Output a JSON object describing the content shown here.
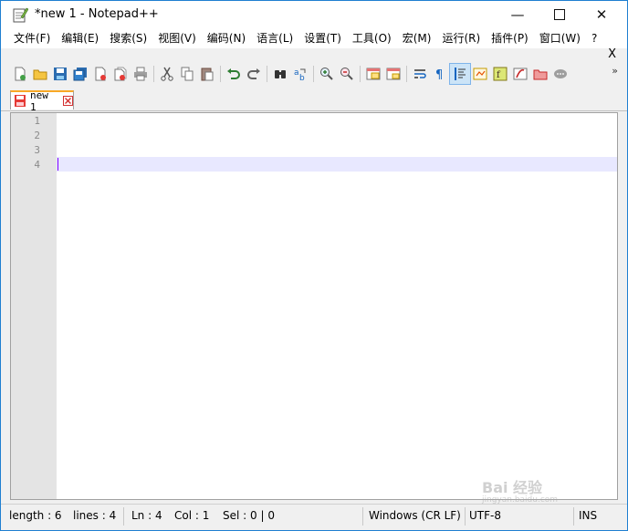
{
  "window": {
    "title": "*new 1 - Notepad++",
    "min_glyph": "—",
    "close_glyph": "✕"
  },
  "menu": {
    "items": [
      "文件(F)",
      "编辑(E)",
      "搜索(S)",
      "视图(V)",
      "编码(N)",
      "语言(L)",
      "设置(T)",
      "工具(O)",
      "宏(M)",
      "运行(R)",
      "插件(P)",
      "窗口(W)",
      "?"
    ],
    "close_doc_glyph": "X"
  },
  "toolbar": {
    "icons": [
      "new-file-icon",
      "open-file-icon",
      "save-icon",
      "save-all-icon",
      "close-icon",
      "close-all-icon",
      "print-icon",
      "cut-icon",
      "copy-icon",
      "paste-icon",
      "undo-icon",
      "redo-icon",
      "find-icon",
      "replace-icon",
      "zoom-in-icon",
      "zoom-out-icon",
      "sync-vertical-icon",
      "sync-horizontal-icon",
      "word-wrap-icon",
      "show-all-chars-icon",
      "indent-guide-icon",
      "doc-map-icon",
      "function-list-icon",
      "folder-workspace-icon",
      "monitoring-icon",
      "macro-icon"
    ],
    "more_glyph": "»"
  },
  "tabs": [
    {
      "label": "new 1",
      "active": true
    }
  ],
  "editor": {
    "line_numbers": [
      "1",
      "2",
      "3",
      "4"
    ],
    "current_line": 4
  },
  "status": {
    "length": "length : 6",
    "lines": "lines : 4",
    "ln": "Ln : 4",
    "col": "Col : 1",
    "sel": "Sel : 0 | 0",
    "eol": "Windows (CR LF)",
    "encoding": "UTF-8",
    "mode": "INS"
  },
  "watermark": {
    "text": "Bai 经验",
    "sub": "jingyan.baidu.com"
  },
  "colors": {
    "accent_tab": "#f9a825",
    "current_line_bg": "#e8e8ff",
    "caret": "#8000ff",
    "desktop": "#1a6fc4"
  }
}
